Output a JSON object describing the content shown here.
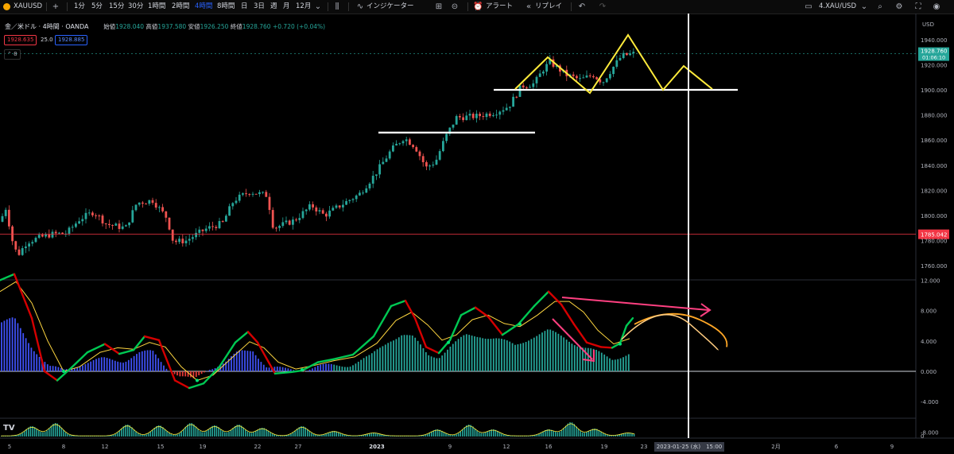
{
  "toolbar": {
    "symbol": "XAUUSD",
    "add_symbol": "+",
    "intervals": [
      "1分",
      "5分",
      "15分",
      "30分",
      "1時間",
      "2時間",
      "4時間",
      "8時間",
      "日",
      "3日",
      "週",
      "月",
      "12月"
    ],
    "active_interval": "4時間",
    "indicators_label": "インジケーター",
    "alert_label": "アラート",
    "replay_label": "リプレイ",
    "layout_label": "4.XAU/USD",
    "colors": {
      "active": "#2962ff",
      "symbol_dot": "#f7a600"
    }
  },
  "legend": {
    "title": "金／米ドル · 4時間 · OANDA",
    "open_label": "始値",
    "open": "1928.040",
    "high_label": "高値",
    "high": "1937.580",
    "low_label": "安値",
    "low": "1926.250",
    "close_label": "終値",
    "close": "1928.760",
    "change": "+0.720 (+0.04%)",
    "bid": "1928.635",
    "spread": "25.0",
    "ask": "1928.885",
    "collapse": "8"
  },
  "price_axis": {
    "labels": [
      "1940.000",
      "1920.000",
      "1900.000",
      "1880.000",
      "1860.000",
      "1840.000",
      "1820.000",
      "1800.000",
      "1780.000",
      "1760.000"
    ],
    "currency": "USD",
    "last_price": "1928.760",
    "countdown": "01:06:10",
    "hline_price": "1785.042"
  },
  "osc_axis": {
    "labels": [
      "12.000",
      "8.000",
      "4.000",
      "0.000",
      "-4.000",
      "-8.000"
    ]
  },
  "vol_axis": {
    "labels": [
      "0"
    ]
  },
  "time_axis": {
    "labels": [
      "5",
      "8",
      "12",
      "15",
      "19",
      "22",
      "27",
      "2023",
      "9",
      "12",
      "16",
      "19",
      "23",
      "2月",
      "6",
      "9"
    ],
    "crosshair_label": "2023-01-25 (水)　15:00"
  },
  "chart_data": {
    "type": "candlestick",
    "y_range": [
      1750,
      1955
    ],
    "levels": {
      "resistance_1": 1866,
      "neckline": 1900,
      "horizontal_line": 1785.042
    },
    "last_close": 1928.76,
    "oscillator_range": [
      -9,
      15
    ],
    "volume_axis_min": 0
  },
  "colors": {
    "up": "#26a69a",
    "down": "#ef5350",
    "hline": "#f23645",
    "yellow": "#ffeb3b",
    "pink": "#ff4081",
    "orange": "#ffa726"
  }
}
